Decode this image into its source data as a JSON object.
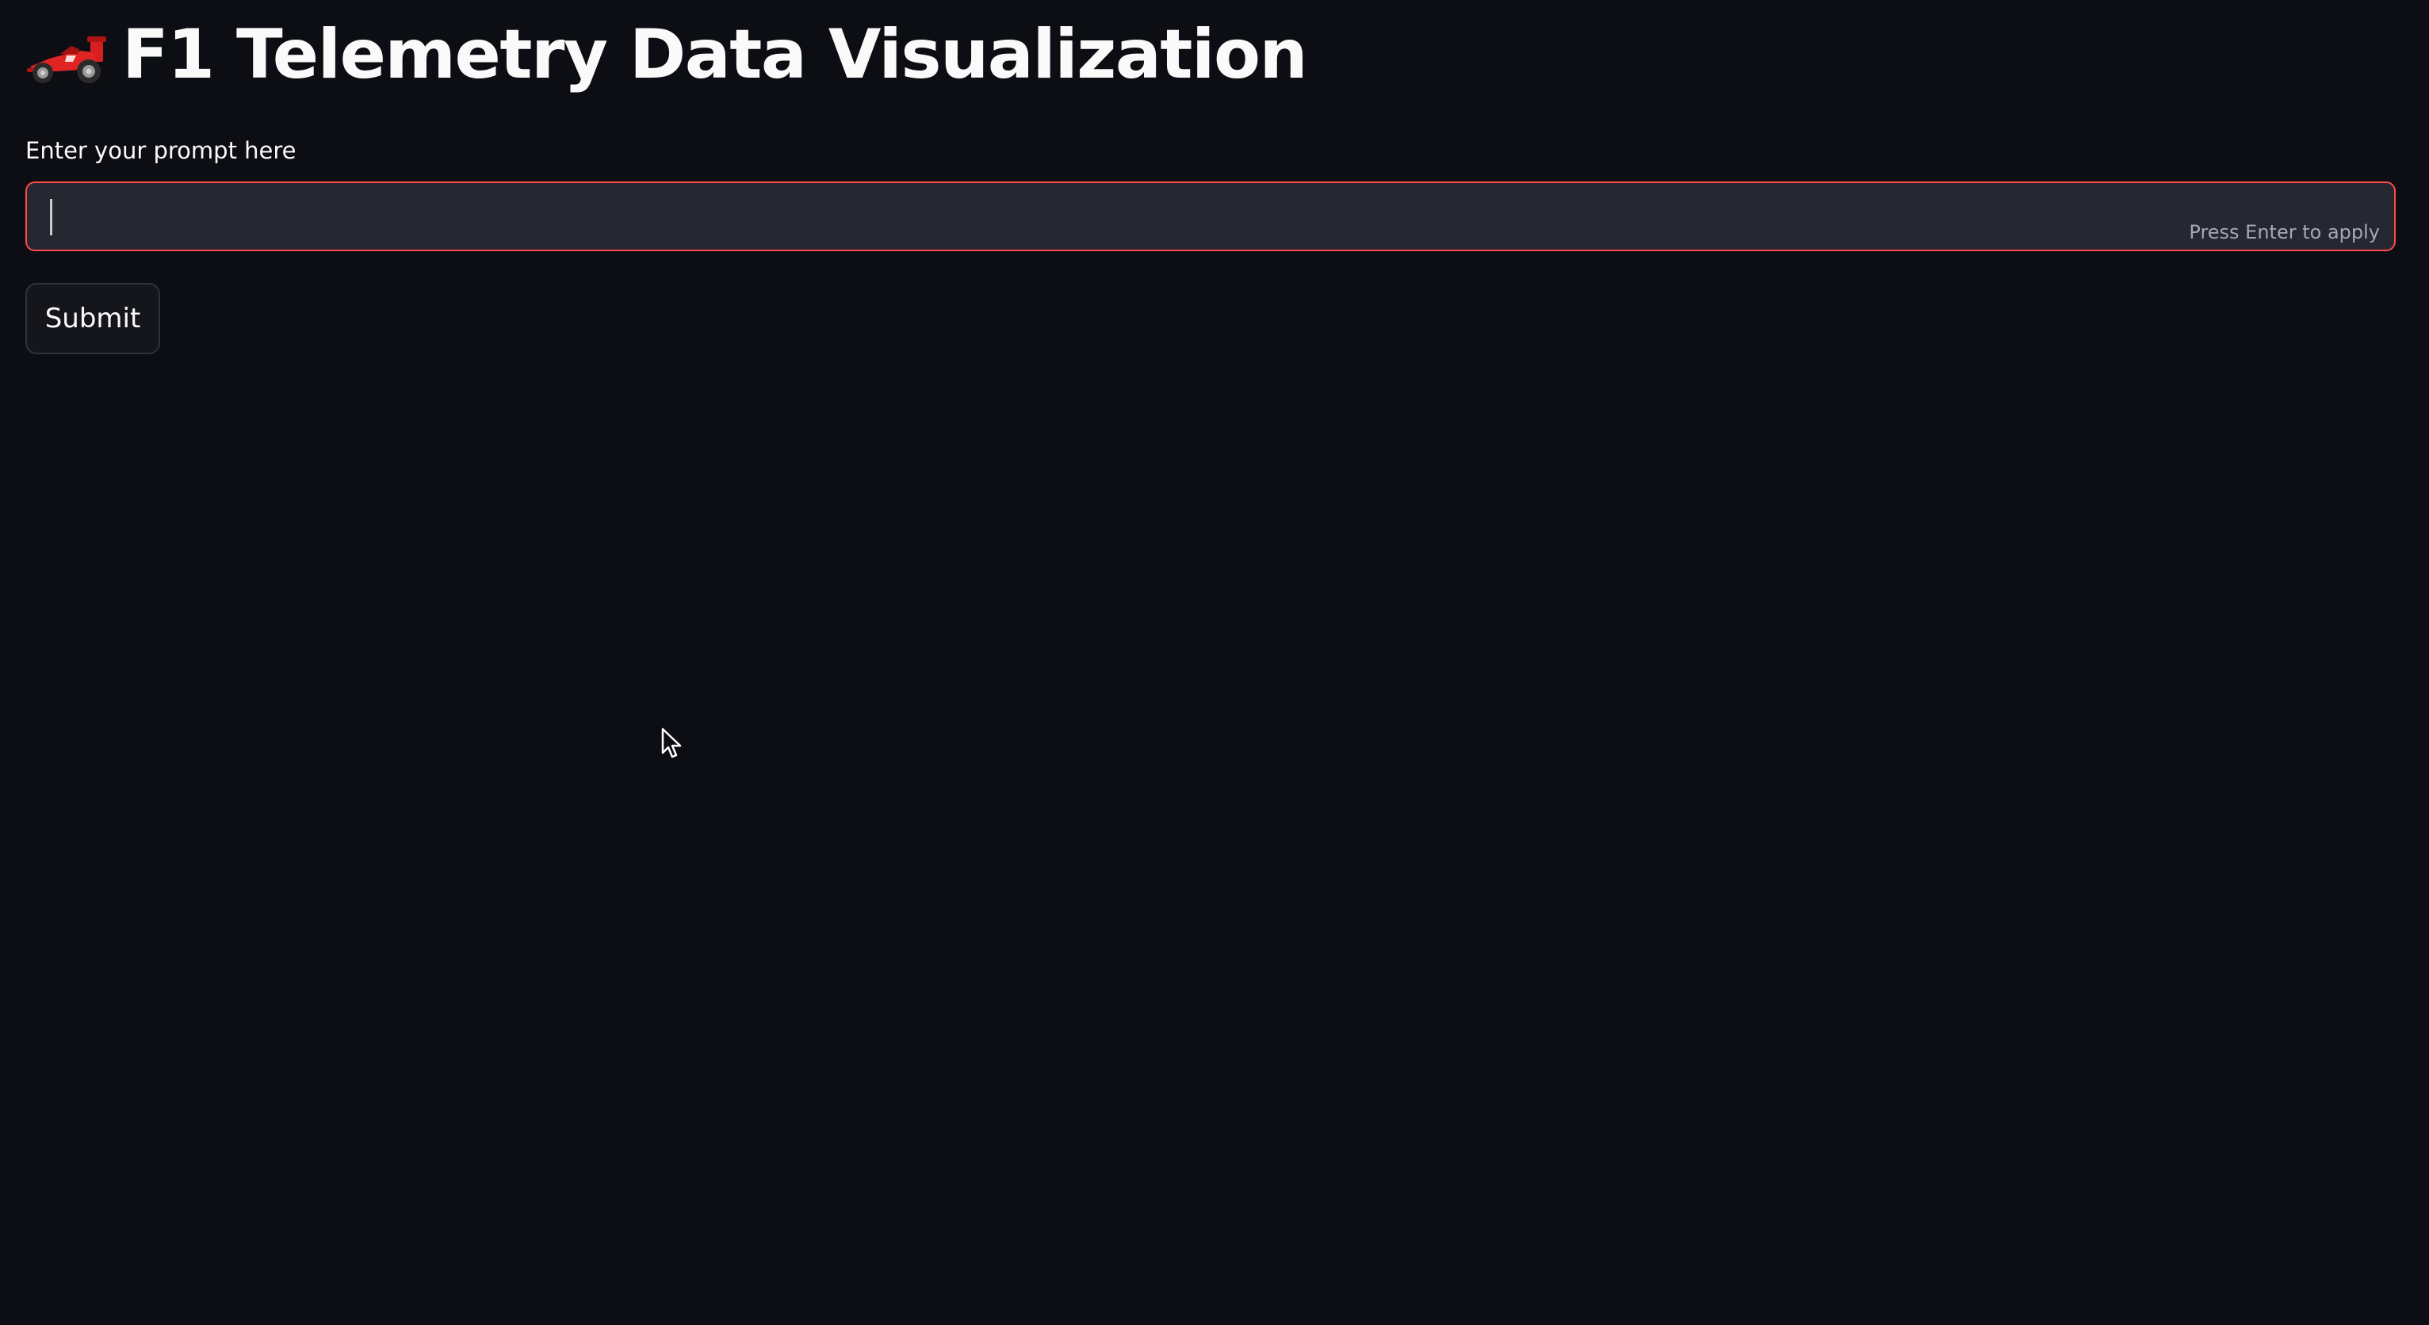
{
  "header": {
    "icon": "race-car-icon",
    "title": "F1 Telemetry Data Visualization"
  },
  "prompt": {
    "label": "Enter your prompt here",
    "value": "",
    "placeholder": "",
    "hint": "Press Enter to apply",
    "focused_border_color": "#ff4b4b"
  },
  "submit": {
    "label": "Submit"
  },
  "colors": {
    "background": "#0c0e14",
    "input_background": "#262730",
    "text": "#fafafa",
    "accent": "#ff4b4b"
  }
}
